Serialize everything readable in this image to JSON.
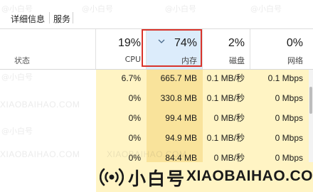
{
  "tabs": [
    {
      "label": "详细信息"
    },
    {
      "label": "服务"
    }
  ],
  "columns": {
    "status": {
      "label": "状态"
    },
    "cpu": {
      "pct": "19%",
      "name": "CPU"
    },
    "memory": {
      "pct": "74%",
      "name": "内存",
      "sort": "descending"
    },
    "disk": {
      "pct": "2%",
      "name": "磁盘"
    },
    "network": {
      "pct": "0%",
      "name": "网络"
    }
  },
  "rows": [
    {
      "cpu": "6.7%",
      "memory": "665.7 MB",
      "disk": "0.1 MB/秒",
      "network": "0.1 Mbps"
    },
    {
      "cpu": "0%",
      "memory": "330.8 MB",
      "disk": "0.1 MB/秒",
      "network": "0 Mbps"
    },
    {
      "cpu": "0%",
      "memory": "99.4 MB",
      "disk": "0 MB/秒",
      "network": "0 Mbps"
    },
    {
      "cpu": "0%",
      "memory": "94.9 MB",
      "disk": "0.1 MB/秒",
      "network": "0 Mbps"
    },
    {
      "cpu": "0%",
      "memory": "84.4 MB",
      "disk": "0 MB/秒",
      "network": "0 Mbps"
    }
  ],
  "watermark": {
    "cn": "@小白号",
    "en": "XIAOBAIHAO.COM",
    "brand_cn": "小白号",
    "brand_en": "XIAOBAIHAO.COM"
  },
  "colors": {
    "highlight": "#d9342b",
    "heat_light": "#fff4c4",
    "heat_medium": "#f9e39b",
    "sorted_header": "#dcecfb"
  },
  "icons": {
    "sort": "chevron-down-icon",
    "logo": "broadcast-icon"
  }
}
